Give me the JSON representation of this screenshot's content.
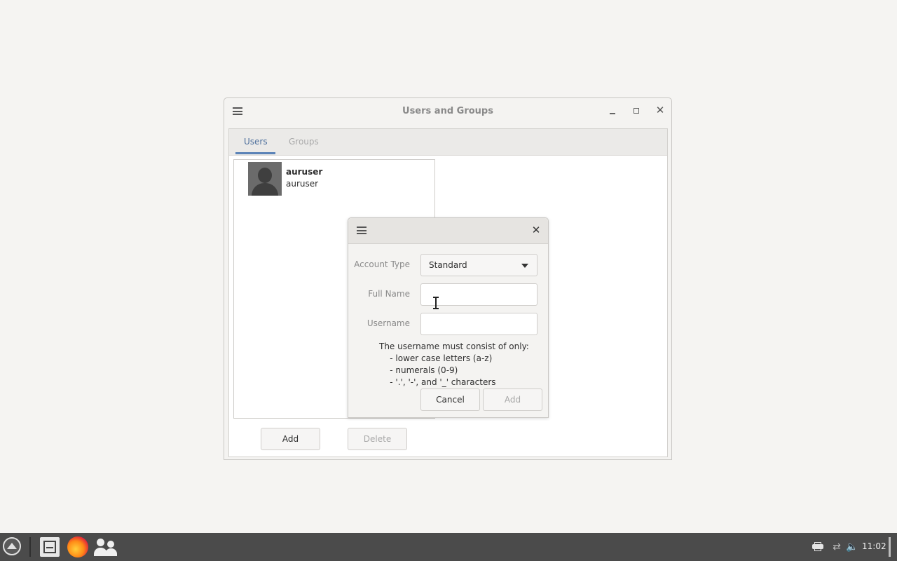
{
  "main_window": {
    "title": "Users and Groups",
    "tabs": [
      {
        "label": "Users",
        "active": true
      },
      {
        "label": "Groups",
        "active": false
      }
    ],
    "users": [
      {
        "full_name": "auruser",
        "username": "auruser"
      }
    ],
    "buttons": {
      "add": "Add",
      "delete": "Delete"
    }
  },
  "dialog": {
    "account_type_label": "Account Type",
    "account_type_value": "Standard",
    "full_name_label": "Full Name",
    "full_name_value": "",
    "username_label": "Username",
    "username_value": "",
    "hint_lines": [
      "The username must consist of only:",
      "    - lower case letters (a-z)",
      "    - numerals (0-9)",
      "    - '.', '-', and '_' characters"
    ],
    "cancel_label": "Cancel",
    "add_label": "Add"
  },
  "taskbar": {
    "clock": "11:02",
    "launchers": [
      "files-icon",
      "firefox-icon",
      "users-groups-icon"
    ],
    "tray_icons": [
      "printer-icon",
      "network-icon",
      "volume-icon"
    ]
  },
  "colors": {
    "accent": "#5b83b7",
    "taskbar": "#4b4b4b",
    "desktop": "#f5f4f2"
  }
}
